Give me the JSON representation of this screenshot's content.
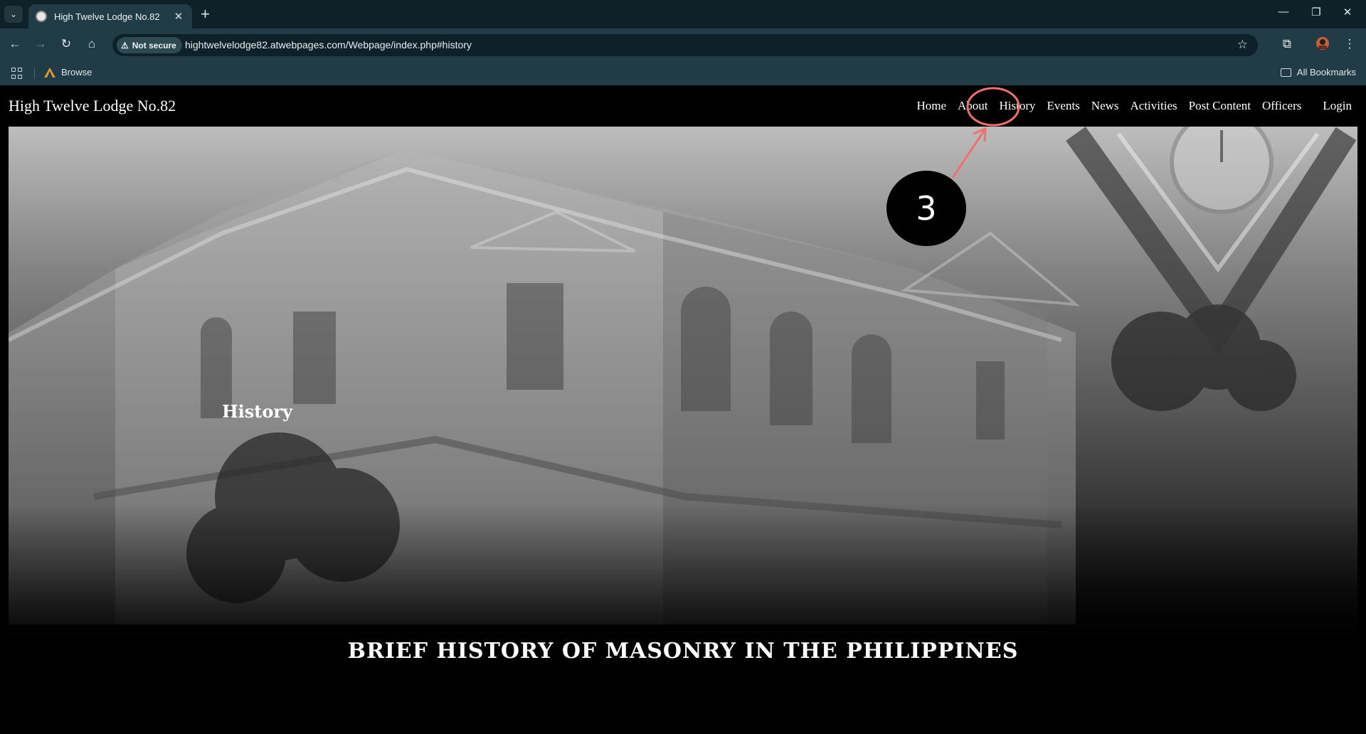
{
  "browser": {
    "tab_title": "High Twelve Lodge No.82",
    "tab_close": "✕",
    "new_tab": "+",
    "security_label": "Not secure",
    "url": "hightwelvelodge82.atwebpages.com/Webpage/index.php#history",
    "bookmarks": {
      "browse_label": "Browse",
      "all_bookmarks_label": "All Bookmarks"
    }
  },
  "site": {
    "brand": "High Twelve Lodge No.82",
    "nav": [
      {
        "label": "Home"
      },
      {
        "label": "About"
      },
      {
        "label": "History"
      },
      {
        "label": "Events"
      },
      {
        "label": "News"
      },
      {
        "label": "Activities"
      },
      {
        "label": "Post Content"
      },
      {
        "label": "Officers"
      }
    ],
    "login_label": "Login",
    "hero_title": "History",
    "section_heading": "BRIEF HISTORY OF MASONRY IN THE PHILIPPINES"
  },
  "annotation": {
    "step_number": "3",
    "highlight_color": "#f07070"
  }
}
